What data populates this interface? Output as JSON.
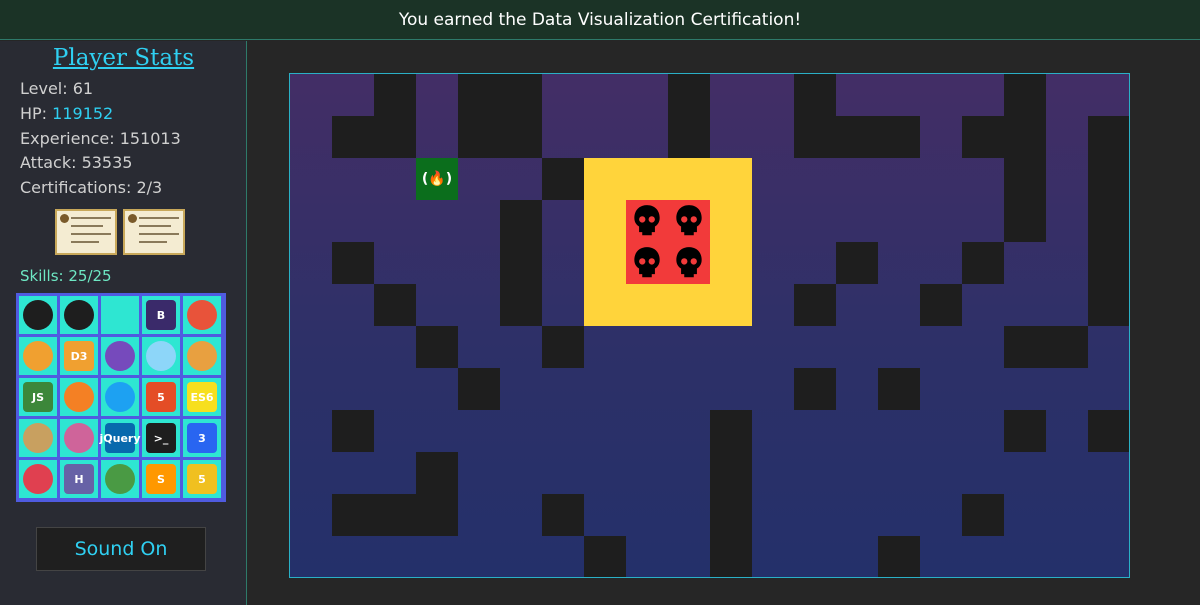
{
  "banner": {
    "message": "You earned the Data Visualization Certification!"
  },
  "stats": {
    "title": "Player Stats",
    "level_label": "Level: ",
    "level": "61",
    "hp_label": "HP: ",
    "hp": "119152",
    "experience_label": "Experience: ",
    "experience": "151013",
    "attack_label": "Attack: ",
    "attack": "53535",
    "certifications_label": "Certifications: ",
    "certifications": "2/3"
  },
  "skills": {
    "label": "Skills: ",
    "count": "25/25",
    "items": [
      {
        "icon": "github-icon",
        "text": ""
      },
      {
        "icon": "codepen-icon",
        "text": ""
      },
      {
        "icon": "react-icon",
        "text": ""
      },
      {
        "icon": "bootstrap-icon",
        "text": "B"
      },
      {
        "icon": "git-icon",
        "text": ""
      },
      {
        "icon": "grunt-icon",
        "text": ""
      },
      {
        "icon": "d3-icon",
        "text": "D3"
      },
      {
        "icon": "redux-icon",
        "text": ""
      },
      {
        "icon": "webpack-icon",
        "text": ""
      },
      {
        "icon": "bower-icon",
        "text": ""
      },
      {
        "icon": "nodejs-icon",
        "text": "JS"
      },
      {
        "icon": "stackoverflow-icon",
        "text": ""
      },
      {
        "icon": "twitter-icon",
        "text": ""
      },
      {
        "icon": "html5-icon",
        "text": "5"
      },
      {
        "icon": "es6-icon",
        "text": "ES6"
      },
      {
        "icon": "jenkins-icon",
        "text": ""
      },
      {
        "icon": "sass-icon",
        "text": ""
      },
      {
        "icon": "jquery-icon",
        "text": "jQuery"
      },
      {
        "icon": "terminal-icon",
        "text": ">_"
      },
      {
        "icon": "css3-icon",
        "text": "3"
      },
      {
        "icon": "gulp-icon",
        "text": ""
      },
      {
        "icon": "heroku-icon",
        "text": "H"
      },
      {
        "icon": "mongodb-icon",
        "text": ""
      },
      {
        "icon": "sublime-icon",
        "text": "S"
      },
      {
        "icon": "js5-icon",
        "text": "5"
      }
    ]
  },
  "sound_button": {
    "label": "Sound On"
  },
  "colors": {
    "accent": "#2fd0f2",
    "room": "#ffd43b",
    "boss": "#f23a3a",
    "player": "#0b6e1c",
    "wall": "#1e1e1e"
  },
  "board_icons": {
    "player": "freecodecamp-icon",
    "boss": "skull-icon"
  }
}
